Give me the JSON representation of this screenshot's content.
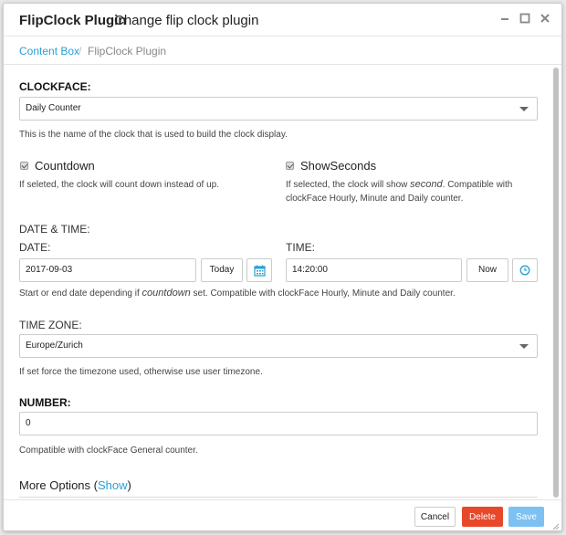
{
  "titlebar": {
    "title": "FlipClock Plugin",
    "subtitle": "Change flip clock plugin"
  },
  "breadcrumb": {
    "link": "Content Box",
    "separator": "/",
    "current": "FlipClock Plugin"
  },
  "clockface": {
    "label": "CLOCKFACE:",
    "value": "Daily Counter",
    "help": "This is the name of the clock that is used to build the clock display."
  },
  "countdown": {
    "label": "Countdown",
    "checked": true,
    "help": "If seleted, the clock will count down instead of up."
  },
  "showseconds": {
    "label": "ShowSeconds",
    "checked": true,
    "help_pre": "If selected, the clock will show ",
    "help_em": "second",
    "help_post": ". Compatible with clockFace Hourly, Minute and Daily counter."
  },
  "datetime": {
    "section_label": "DATE & TIME:",
    "date_label": "DATE:",
    "date_value": "2017-09-03",
    "today_button": "Today",
    "time_label": "TIME:",
    "time_value": "14:20:00",
    "now_button": "Now",
    "help_pre": "Start or end date depending if ",
    "help_em": "countdown",
    "help_post": " set. Compatible with clockFace Hourly, Minute and Daily counter."
  },
  "timezone": {
    "label": "TIME ZONE:",
    "value": "Europe/Zurich",
    "help": "If set force the timezone used, otherwise use user timezone."
  },
  "number": {
    "label": "NUMBER:",
    "value": "0",
    "help": "Compatible with clockFace General counter."
  },
  "more_options": {
    "label": "More Options (",
    "link": "Show",
    "close": ")"
  },
  "footer": {
    "cancel": "Cancel",
    "delete": "Delete",
    "save": "Save"
  },
  "colors": {
    "accent": "#2a9fd6",
    "delete": "#e8472a",
    "save": "#7cc1f2"
  },
  "icons": {
    "minimize": "minimize-icon",
    "maximize": "maximize-icon",
    "close": "close-icon",
    "calendar": "calendar-icon",
    "clock": "clock-icon"
  }
}
